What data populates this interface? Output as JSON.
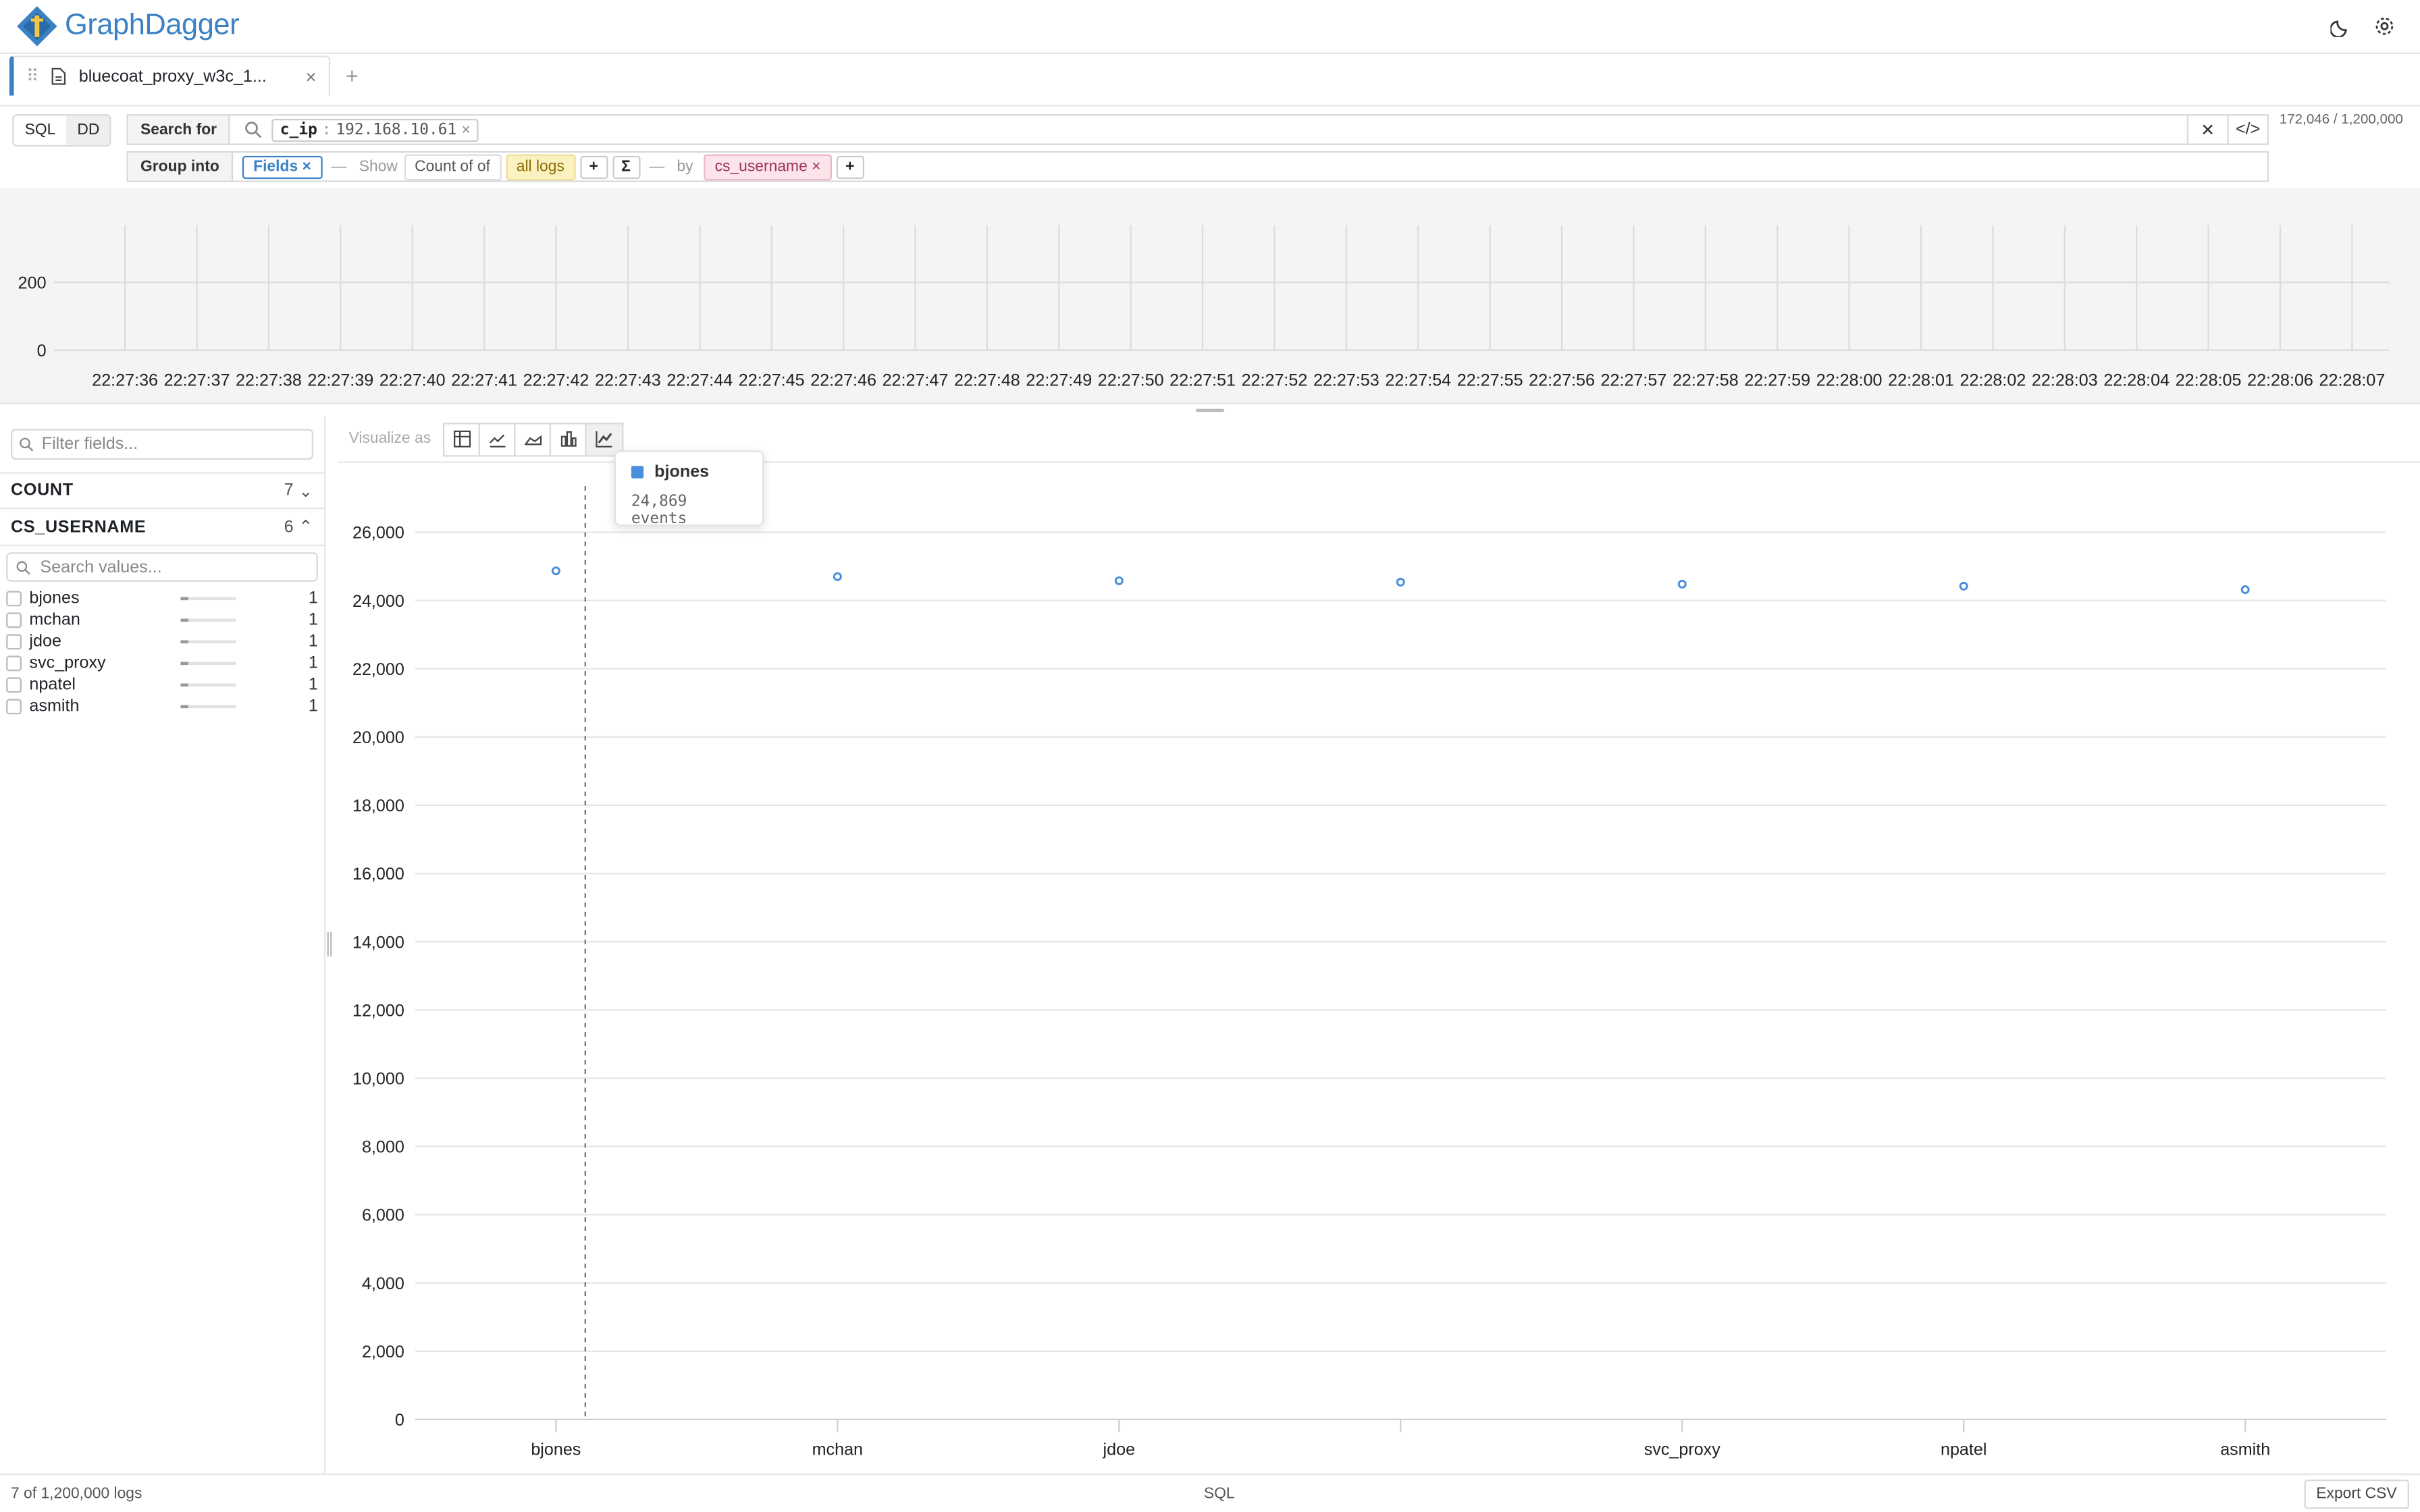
{
  "app": {
    "name": "GraphDagger"
  },
  "tab": {
    "name": "bluecoat_proxy_w3c_1..."
  },
  "query": {
    "mode_sql": "SQL",
    "mode_dd": "DD",
    "search_label": "Search for",
    "filter_key": "c_ip",
    "filter_value": "192.168.10.61",
    "group_label": "Group into",
    "group_chip": "Fields",
    "show_label": "Show",
    "show_agg": "Count of of",
    "show_target": "all logs",
    "by_label": "by",
    "by_field": "cs_username",
    "plus": "+",
    "sigma": "Σ",
    "counts": "172,046 / 1,200,000"
  },
  "histogram": {
    "y_ticks": [
      "200",
      "0"
    ],
    "x_ticks": [
      "22:27:36",
      "22:27:37",
      "22:27:38",
      "22:27:39",
      "22:27:40",
      "22:27:41",
      "22:27:42",
      "22:27:43",
      "22:27:44",
      "22:27:45",
      "22:27:46",
      "22:27:47",
      "22:27:48",
      "22:27:49",
      "22:27:50",
      "22:27:51",
      "22:27:52",
      "22:27:53",
      "22:27:54",
      "22:27:55",
      "22:27:56",
      "22:27:57",
      "22:27:58",
      "22:27:59",
      "22:28:00",
      "22:28:01",
      "22:28:02",
      "22:28:03",
      "22:28:04",
      "22:28:05",
      "22:28:06",
      "22:28:07"
    ]
  },
  "sidebar": {
    "filter_placeholder": "Filter fields...",
    "fields": [
      {
        "name": "COUNT",
        "count": "7"
      },
      {
        "name": "CS_USERNAME",
        "count": "6"
      }
    ],
    "values_placeholder": "Search values...",
    "values": [
      {
        "name": "bjones",
        "count": "1",
        "fraction": 0.15
      },
      {
        "name": "mchan",
        "count": "1",
        "fraction": 0.15
      },
      {
        "name": "jdoe",
        "count": "1",
        "fraction": 0.15
      },
      {
        "name": "svc_proxy",
        "count": "1",
        "fraction": 0.15
      },
      {
        "name": "npatel",
        "count": "1",
        "fraction": 0.15
      },
      {
        "name": "asmith",
        "count": "1",
        "fraction": 0.15
      }
    ]
  },
  "viz": {
    "label": "Visualize as",
    "tooltip_name": "bjones",
    "tooltip_value": "24,869 events"
  },
  "chart_data": {
    "type": "scatter",
    "categories": [
      "bjones",
      "mchan",
      "jdoe",
      "",
      "svc_proxy",
      "npatel",
      "asmith"
    ],
    "series": [
      {
        "name": "bjones",
        "values": [
          24869,
          24700,
          24580,
          24540,
          24480,
          24420,
          24320
        ]
      }
    ],
    "ylim": [
      0,
      26000
    ],
    "y_ticks": [
      "0",
      "2,000",
      "4,000",
      "6,000",
      "8,000",
      "10,000",
      "12,000",
      "14,000",
      "16,000",
      "18,000",
      "20,000",
      "22,000",
      "24,000",
      "26,000"
    ],
    "grid": true,
    "color": "#4a8fdb"
  },
  "status": {
    "left": "7 of 1,200,000 logs",
    "mid": "SQL",
    "export": "Export CSV"
  }
}
